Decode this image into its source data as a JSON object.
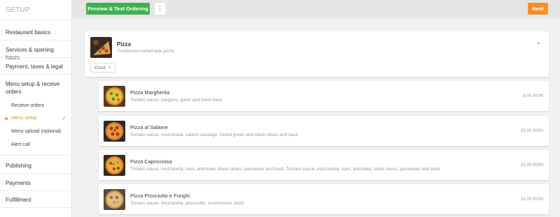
{
  "sidebar": {
    "title": "SETUP",
    "items": [
      {
        "label": "Restaurant basics"
      },
      {
        "label": "Services & opening hours"
      },
      {
        "label": "Payment, taxes & legal"
      },
      {
        "label": "Menu setup & receive orders"
      }
    ],
    "subitems": [
      {
        "label": "Receive orders"
      },
      {
        "label": "Menu setup",
        "active": true
      },
      {
        "label": "Menu upload (optional)"
      },
      {
        "label": "Alert call"
      }
    ],
    "bottom_items": [
      {
        "label": "Publishing"
      },
      {
        "label": "Payments"
      },
      {
        "label": "Fulfillment"
      }
    ]
  },
  "toolbar": {
    "preview_label": "Preview & Test Ordering",
    "more_label": "⋮",
    "next_label": "Next"
  },
  "category": {
    "name": "Pizza",
    "description": "Traditional homemade pizza",
    "tag": "Crust",
    "tag_remove": "×",
    "collapse_icon": "⌃"
  },
  "items": [
    {
      "name": "Pizza Margherita",
      "description": "Tomato sauce, oregano, garlic and fresh basil",
      "price": "8.00 RON"
    },
    {
      "name": "Pizza al Salame",
      "description": "Tomato sauce, mozzarella, salami sausage, mixed green and black olives and basil",
      "price": "10.00 RON"
    },
    {
      "name": "Pizza Capricciosa",
      "description": "Tomato sauce, mozzarella, ham, artichoke, black olives, parmesan and basil, Tomato sauce, mozzarella, ham, artichoke, black olives, parmesan and basil",
      "price": "10.00 RON"
    },
    {
      "name": "Pizza Prosciutto e Funghi",
      "description": "Tomato sauce, mozzarella, prosciutto, mushrooms, basil",
      "price": "11.00 RON"
    }
  ],
  "colors": {
    "primary_green": "#3fb153",
    "accent_orange": "#f0922b"
  }
}
